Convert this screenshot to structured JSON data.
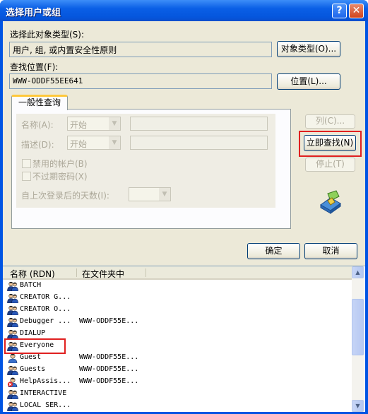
{
  "window": {
    "title": "选择用户或组",
    "help_glyph": "?",
    "close_glyph": "✕"
  },
  "object_type": {
    "label": "选择此对象类型(S):",
    "value": "用户, 组, 或内置安全性原则",
    "button": "对象类型(O)..."
  },
  "location": {
    "label": "查找位置(F):",
    "value": "WWW-ODDF55EE641",
    "button": "位置(L)..."
  },
  "query": {
    "tab_label": "一般性查询",
    "name_label": "名称(A):",
    "name_mode": "开始",
    "desc_label": "描述(D):",
    "desc_mode": "开始",
    "disabled_accounts": "禁用的帐户(B)",
    "non_expiring_pw": "不过期密码(X)",
    "days_since_login": "自上次登录后的天数(I):",
    "dropdown_arrow": "▼"
  },
  "side_buttons": {
    "columns": "列(C)...",
    "find_now": "立即查找(N)",
    "stop": "停止(T)"
  },
  "dialog_buttons": {
    "ok": "确定",
    "cancel": "取消"
  },
  "results": {
    "col_name": "名称 (RDN)",
    "col_folder": "在文件夹中",
    "scroll_up": "▲",
    "scroll_down": "▼",
    "rows": [
      {
        "name": "BATCH",
        "folder": ""
      },
      {
        "name": "CREATOR G...",
        "folder": ""
      },
      {
        "name": "CREATOR O...",
        "folder": ""
      },
      {
        "name": "Debugger ...",
        "folder": "WWW-ODDF55E..."
      },
      {
        "name": "DIALUP",
        "folder": ""
      },
      {
        "name": "Everyone",
        "folder": ""
      },
      {
        "name": "Guest",
        "folder": "WWW-ODDF55E..."
      },
      {
        "name": "Guests",
        "folder": "WWW-ODDF55E..."
      },
      {
        "name": "HelpAssis...",
        "folder": "WWW-ODDF55E..."
      },
      {
        "name": "INTERACTIVE",
        "folder": ""
      },
      {
        "name": "LOCAL SER...",
        "folder": ""
      }
    ]
  }
}
